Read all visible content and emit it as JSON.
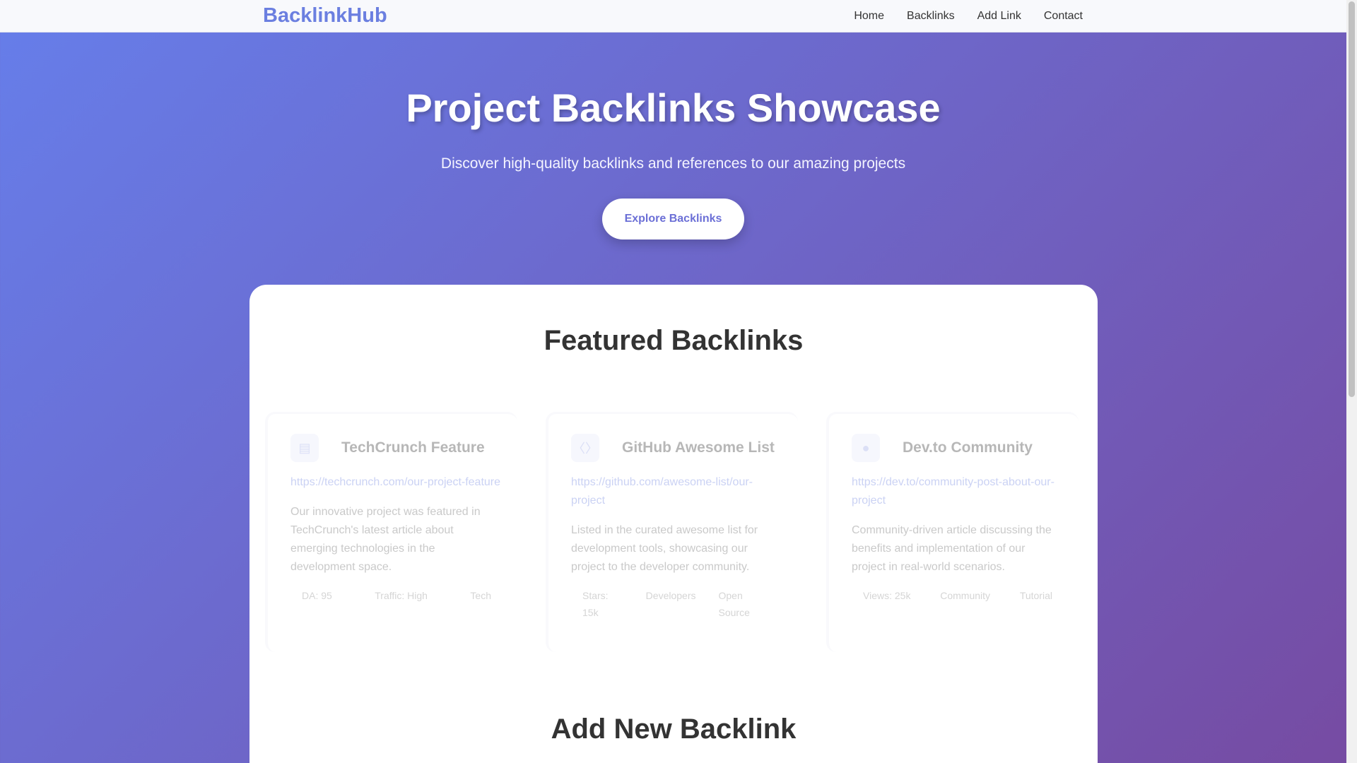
{
  "nav": {
    "logo": "BacklinkHub",
    "links": [
      "Home",
      "Backlinks",
      "Add Link",
      "Contact"
    ]
  },
  "hero": {
    "title": "Project Backlinks Showcase",
    "subtitle": "Discover high-quality backlinks and references to our amazing projects",
    "button": "Explore Backlinks"
  },
  "featured": {
    "title": "Featured Backlinks",
    "cards": [
      {
        "title": "TechCrunch Feature",
        "url": "https://techcrunch.com/our-project-feature",
        "description": "Our innovative project was featured in TechCrunch's latest article about emerging technologies in the development space.",
        "tags": [
          "DA: 95",
          "Traffic: High",
          "Tech"
        ]
      },
      {
        "title": "GitHub Awesome List",
        "url": "https://github.com/awesome-list/our-project",
        "description": "Listed in the curated awesome list for development tools, showcasing our project to the developer community.",
        "tags": [
          "Stars: 15k",
          "Developers",
          "Open Source"
        ]
      },
      {
        "title": "Dev.to Community",
        "url": "https://dev.to/community-post-about-our-project",
        "description": "Community-driven article discussing the benefits and implementation of our project in real-world scenarios.",
        "tags": [
          "Views: 25k",
          "Community",
          "Tutorial"
        ]
      }
    ]
  },
  "add_section": {
    "title": "Add New Backlink"
  },
  "colors": {
    "accent": "#6b7fe0",
    "gradient_start": "#667eea",
    "gradient_end": "#764ba2"
  }
}
